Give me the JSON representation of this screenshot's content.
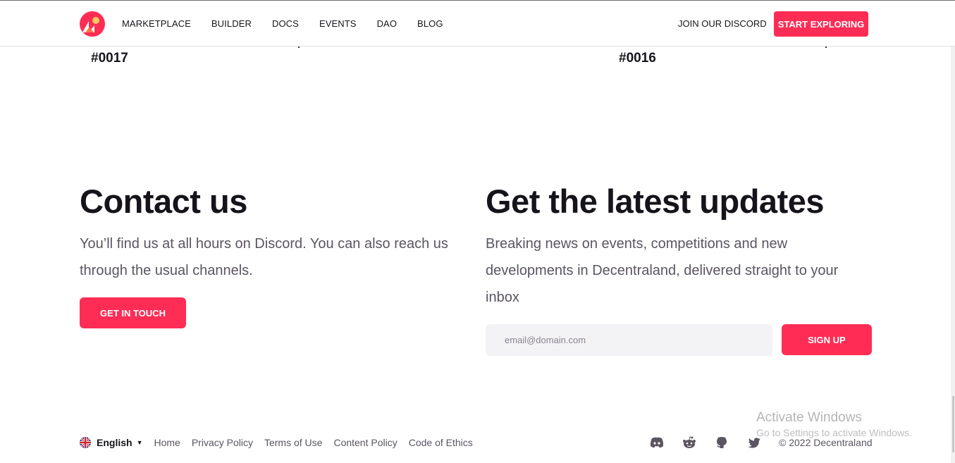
{
  "header": {
    "nav": [
      "MARKETPLACE",
      "BUILDER",
      "DOCS",
      "EVENTS",
      "DAO",
      "BLOG"
    ],
    "discord_label": "JOIN OUR DISCORD",
    "cta_label": "START EXPLORING"
  },
  "cards": {
    "left_id": "#0017",
    "right_id": "#0016"
  },
  "contact": {
    "title": "Contact us",
    "body": "You’ll find us at all hours on Discord. You can also reach us through the usual channels.",
    "button": "GET IN TOUCH"
  },
  "updates": {
    "title": "Get the latest updates",
    "body": "Breaking news on events, competitions and new developments in Decentraland, delivered straight to your inbox",
    "email_placeholder": "email@domain.com",
    "button": "SIGN UP"
  },
  "footer": {
    "language": "English",
    "links": [
      "Home",
      "Privacy Policy",
      "Terms of Use",
      "Content Policy",
      "Code of Ethics"
    ],
    "social_icons": [
      "discord-icon",
      "reddit-icon",
      "github-icon",
      "twitter-icon"
    ],
    "copyright": "© 2022 Decentraland"
  },
  "os_watermark": {
    "title": "Activate Windows",
    "subtitle": "Go to Settings to activate Windows."
  },
  "colors": {
    "accent": "#ff2d55",
    "text": "#16141a",
    "muted": "#5a5560",
    "input_bg": "#f3f2f5"
  }
}
